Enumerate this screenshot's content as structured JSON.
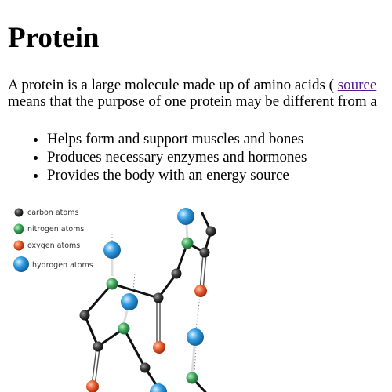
{
  "heading": "Protein",
  "intro": {
    "line1_before_link": "A protein is a large molecule made up of amino acids ( ",
    "link_text": "source",
    "line2": "means that the purpose of one protein may be different from a"
  },
  "facts": [
    "Helps form and support muscles and bones",
    "Produces necessary enzymes and hormones",
    "Provides the body with an energy source"
  ],
  "diagram": {
    "legend": [
      {
        "label": "carbon atoms",
        "color": "#3a3a3a"
      },
      {
        "label": "nitrogen atoms",
        "color": "#3fa65a"
      },
      {
        "label": "oxygen atoms",
        "color": "#e8582c"
      },
      {
        "label": "hydrogen atoms",
        "color": "#2e9be0"
      }
    ]
  }
}
